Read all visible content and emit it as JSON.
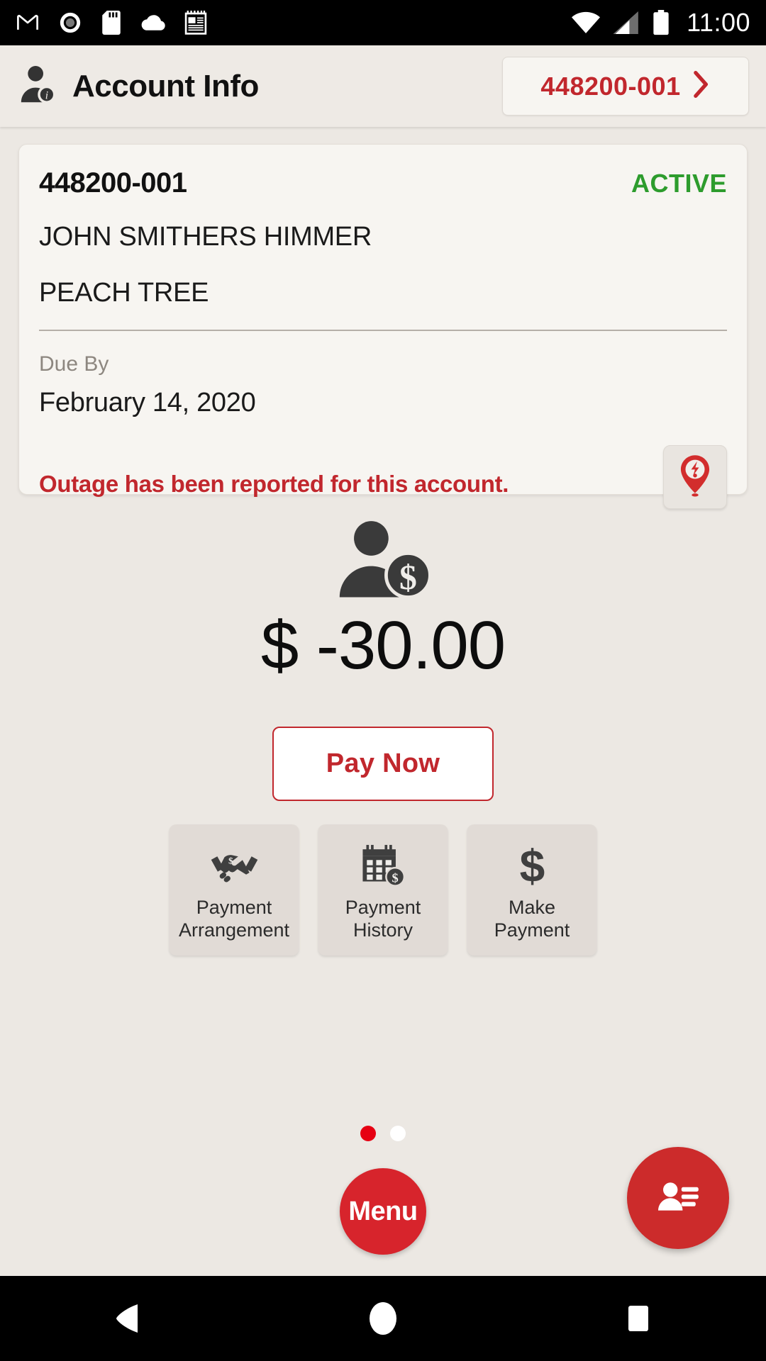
{
  "statusbar": {
    "icons_left": [
      "gmail-icon",
      "record-icon",
      "sdcard-icon",
      "cloud-icon",
      "notepad-icon"
    ],
    "icons_right": [
      "wifi-icon",
      "signal-icon",
      "battery-icon"
    ],
    "clock": "11:00"
  },
  "header": {
    "icon": "account-info-icon",
    "title": "Account Info",
    "account_chip": {
      "label": "448200-001",
      "chevron": "chevron-right-icon"
    }
  },
  "account_card": {
    "account_number": "448200-001",
    "status": "ACTIVE",
    "status_color": "#2d9c2d",
    "customer_name": "JOHN SMITHERS HIMMER",
    "address": "PEACH TREE",
    "due_by_label": "Due By",
    "due_by_date": "February 14, 2020",
    "outage_message": "Outage has been reported for this account.",
    "outage_icon": "outage-pin-icon",
    "alert_color": "#c1272d"
  },
  "balance": {
    "icon": "customer-balance-icon",
    "amount": "$ -30.00",
    "pay_now_label": "Pay Now",
    "accent_color": "#c1272d"
  },
  "tiles": [
    {
      "icon": "handshake-dollar-icon",
      "line1": "Payment",
      "line2": "Arrangement"
    },
    {
      "icon": "calendar-dollar-icon",
      "line1": "Payment",
      "line2": "History"
    },
    {
      "icon": "dollar-sign-icon",
      "line1": "Make",
      "line2": "Payment"
    }
  ],
  "pager": {
    "dots": [
      {
        "state": "active",
        "color": "#e60012"
      },
      {
        "state": "inactive",
        "color": "#ffffff"
      }
    ]
  },
  "bottom": {
    "menu_label": "Menu",
    "menu_color": "#d7242c",
    "contact_icon": "contact-card-icon",
    "contact_color": "#cc2b2b"
  },
  "navbar": {
    "back": "back-triangle-icon",
    "home": "home-circle-icon",
    "recents": "recents-square-icon"
  }
}
